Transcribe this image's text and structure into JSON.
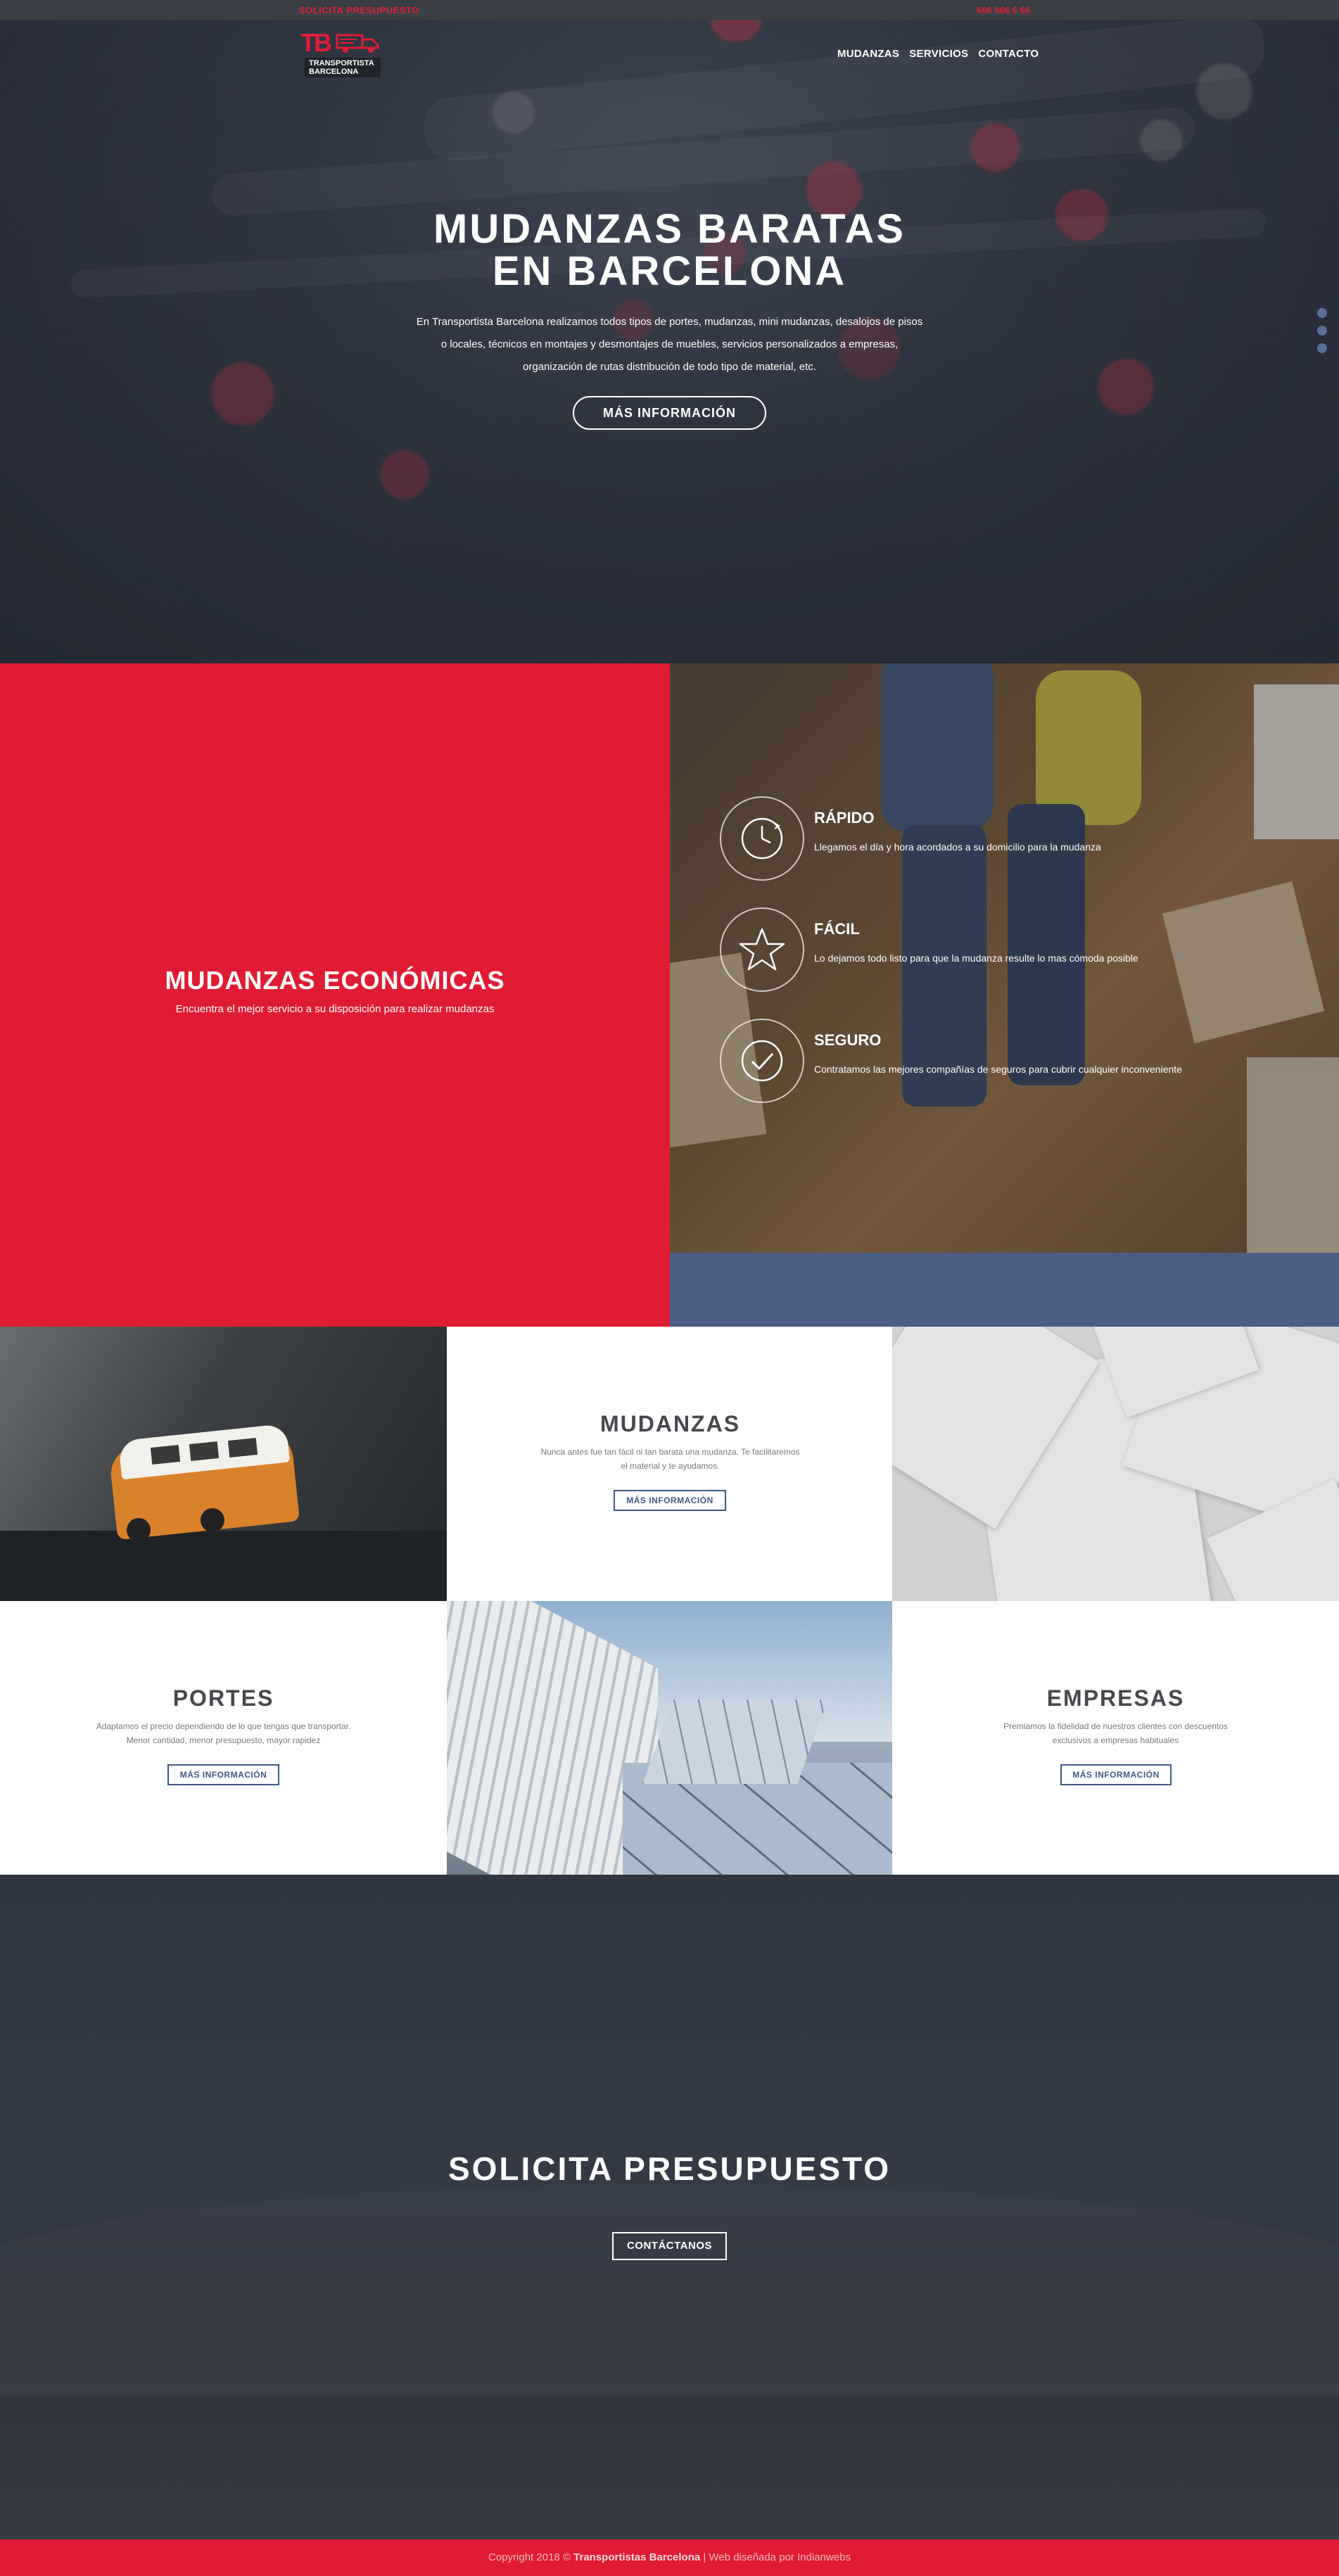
{
  "topbar": {
    "quote_link": "SOLICITA PRESUPUESTO",
    "phone": "666 666 6 66"
  },
  "logo": {
    "mark": "TB",
    "line1": "TRANSPORTISTA",
    "line2": "BARCELONA"
  },
  "nav": [
    "MUDANZAS",
    "SERVICIOS",
    "CONTACTO"
  ],
  "hero": {
    "title_line1": "MUDANZAS BARATAS",
    "title_line2": "EN BARCELONA",
    "description": "En Transportista Barcelona realizamos todos tipos de portes, mudanzas, mini mudanzas, desalojos de pisos o locales, técnicos en montajes y desmontajes de muebles, servicios personalizados a empresas, organización de rutas distribución de todo tipo de material, etc.",
    "button": "MÁS INFORMACIÓN"
  },
  "features": {
    "title": "MUDANZAS ECONÓMICAS",
    "subtitle": "Encuentra el mejor servicio a su disposición para realizar mudanzas",
    "items": [
      {
        "icon": "clock-icon",
        "title": "RÁPIDO",
        "text": "Llegamos el día y hora acordados a su domicilio para la mudanza"
      },
      {
        "icon": "star-icon",
        "title": "FÁCIL",
        "text": "Lo dejamos todo listo para que la mudanza resulte lo mas cómoda posible"
      },
      {
        "icon": "check-circle-icon",
        "title": "SEGURO",
        "text": "Contratamos las mejores compañías de seguros para cubrir cualquier inconveniente"
      }
    ]
  },
  "services": {
    "mudanzas": {
      "title": "MUDANZAS",
      "text": "Nunca antes fue tan fácil ni tan barata una mudanza. Te facilitaremos el material y te ayudamos.",
      "button": "MÁS INFORMACIÓN"
    },
    "portes": {
      "title": "PORTES",
      "text": "Adaptamos el precio dependiendo de lo que tengas que transportar. Menor cantidad, menor presupuesto, mayor rapidez",
      "button": "MÁS INFORMACIÓN"
    },
    "empresas": {
      "title": "EMPRESAS",
      "text": "Premiamos la fidelidad de nuestros clientes con descuentos exclusivos a empresas habituales",
      "button": "MÁS INFORMACIÓN"
    }
  },
  "cta": {
    "title": "SOLICITA PRESUPUESTO",
    "button": "CONTÁCTANOS"
  },
  "footer": {
    "prefix": "Copyright 2018 ©",
    "brand": "Transportistas Barcelona",
    "suffix": "| Web diseñada por Indianwebs"
  },
  "colors": {
    "brand_red": "#e01c34",
    "navy": "#4b5f83",
    "dark": "#2d3340"
  }
}
